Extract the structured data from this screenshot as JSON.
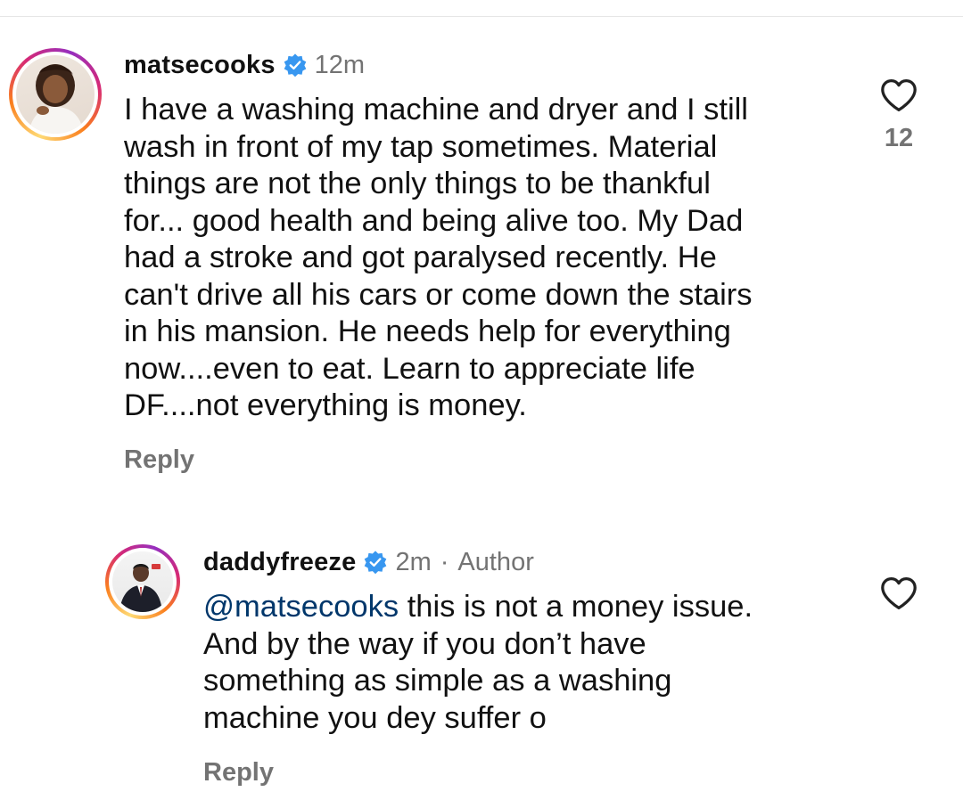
{
  "comments": [
    {
      "username": "matsecooks",
      "verified": true,
      "time": "12m",
      "body_lines": [
        "I have a washing machine and dryer and I still",
        "wash in front of my tap sometimes. Material",
        "things are not the only things to be thankful",
        "for... good health and being alive too. My Dad",
        "had a stroke and got paralysed recently.  He",
        "can't drive all his cars or come down the stairs",
        "in his mansion.  He needs help for everything",
        "now....even to eat. Learn to appreciate life",
        "DF....not everything is money."
      ],
      "reply_label": "Reply",
      "like_count": "12",
      "like_icon": "heart-outline-icon"
    },
    {
      "username": "daddyfreeze",
      "verified": true,
      "time": "2m",
      "separator": "·",
      "author_label": "Author",
      "mention": "@matsecooks",
      "body_first_rest": " this is not a money issue.",
      "body_lines": [
        "And by the way if you don’t have",
        "something as simple as a washing",
        "machine you dey suffer o"
      ],
      "reply_label": "Reply",
      "like_icon": "heart-outline-icon"
    }
  ],
  "colors": {
    "text": "#111111",
    "secondary": "#737373",
    "mention": "#00376b",
    "verified_badge": "#3897f0"
  }
}
